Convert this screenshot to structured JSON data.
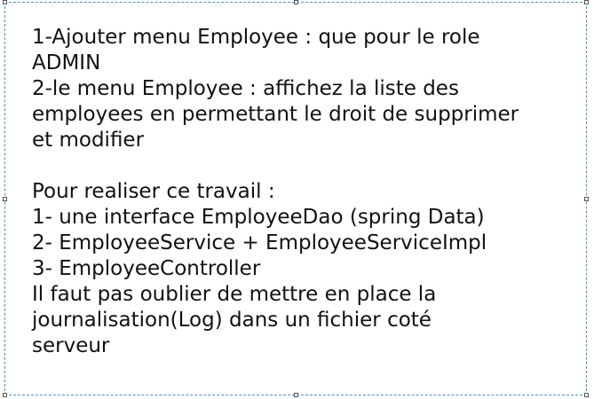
{
  "text_box": {
    "lines": [
      "1-Ajouter menu Employee : que pour le role",
      "ADMIN",
      "2-le menu Employee : affichez la liste des",
      "employees en permettant le droit de supprimer",
      "et modifier",
      "",
      "Pour realiser ce travail :",
      "1- une interface EmployeeDao (spring Data)",
      "2- EmployeeService + EmployeeServiceImpl",
      "3- EmployeeController",
      "Il faut pas oublier de mettre en place la",
      "journalisation(Log) dans un fichier coté",
      "serveur"
    ]
  },
  "colors": {
    "border": "#4a90c8",
    "text": "#111111"
  }
}
